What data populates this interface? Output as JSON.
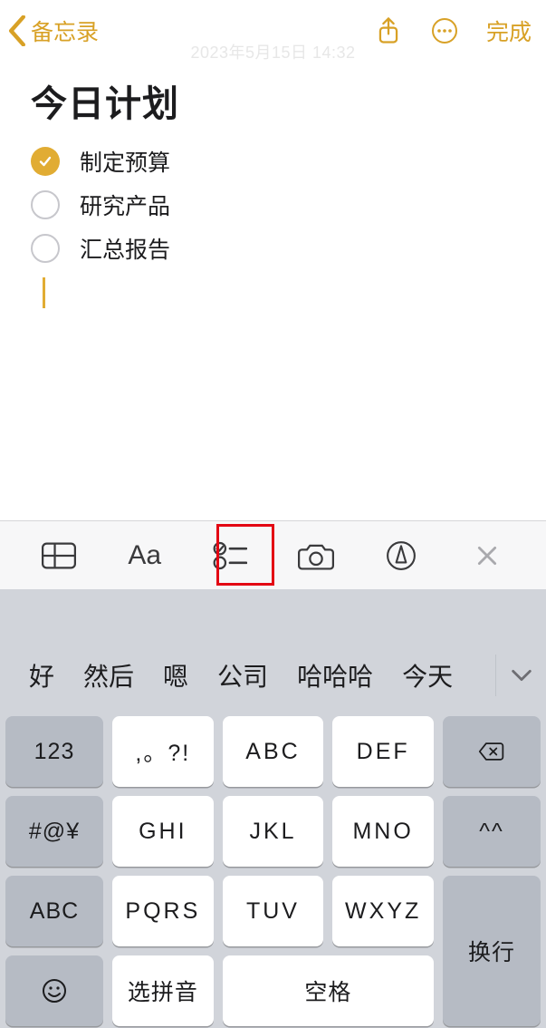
{
  "nav": {
    "back_label": "备忘录",
    "done_label": "完成",
    "timestamp": "2023年5月15日 14:32"
  },
  "note": {
    "title": "今日计划",
    "items": [
      {
        "text": "制定预算",
        "checked": true
      },
      {
        "text": "研究产品",
        "checked": false
      },
      {
        "text": "汇总报告",
        "checked": false
      }
    ]
  },
  "fmt_bar": {
    "aa_label": "Aa"
  },
  "candidates": [
    "好",
    "然后",
    "嗯",
    "公司",
    "哈哈哈",
    "今天"
  ],
  "keyboard": {
    "row1": {
      "fn": "123",
      "k1": ",。?!",
      "k2": "ABC",
      "k3": "DEF"
    },
    "row2": {
      "fn": "#@¥",
      "k1": "GHI",
      "k2": "JKL",
      "k3": "MNO",
      "face": "^^"
    },
    "row3": {
      "fn": "ABC",
      "k1": "PQRS",
      "k2": "TUV",
      "k3": "WXYZ"
    },
    "row4": {
      "emoji": "☺",
      "ime": "选拼音",
      "space": "空格",
      "enter": "换行"
    }
  }
}
